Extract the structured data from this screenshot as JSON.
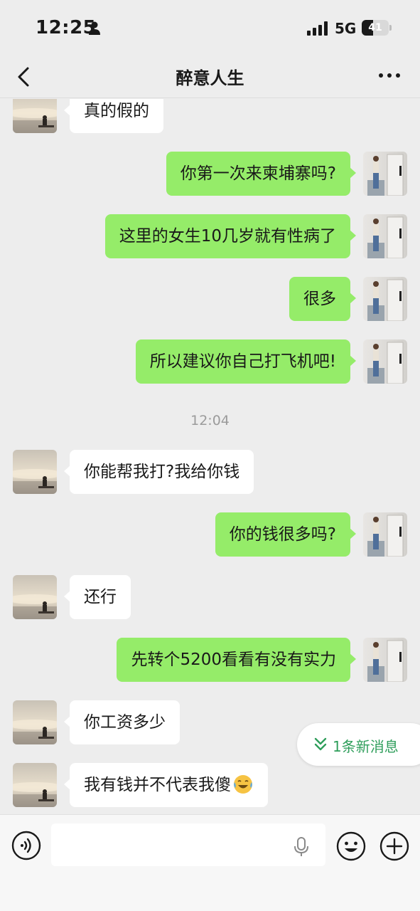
{
  "status_bar": {
    "time": "12:25",
    "network": "5G",
    "battery": "41",
    "battery_level": 0.41
  },
  "header": {
    "title": "醉意人生"
  },
  "messages": [
    {
      "from": "them",
      "text": "真的假的"
    },
    {
      "from": "me",
      "text": "你第一次来柬埔寨吗?"
    },
    {
      "from": "me",
      "text": "这里的女生10几岁就有性病了"
    },
    {
      "from": "me",
      "text": "很多"
    },
    {
      "from": "me",
      "text": "所以建议你自己打飞机吧!"
    },
    {
      "from": "time",
      "text": "12:04"
    },
    {
      "from": "them",
      "text": "你能帮我打?我给你钱"
    },
    {
      "from": "me",
      "text": "你的钱很多吗?"
    },
    {
      "from": "them",
      "text": "还行"
    },
    {
      "from": "me",
      "text": "先转个5200看看有没有实力"
    },
    {
      "from": "them",
      "text": "你工资多少"
    },
    {
      "from": "them",
      "text": "我有钱并不代表我傻",
      "emoji": "laughing-crying-emoji"
    }
  ],
  "new_messages_pill": {
    "text": "1条新消息",
    "icon": "double-chevron-down-icon",
    "color": "#2f9e5b"
  },
  "input_bar": {
    "value": "",
    "placeholder": ""
  },
  "colors": {
    "outgoing_bubble": "#95ec69",
    "incoming_bubble": "#ffffff",
    "background": "#ededed"
  }
}
